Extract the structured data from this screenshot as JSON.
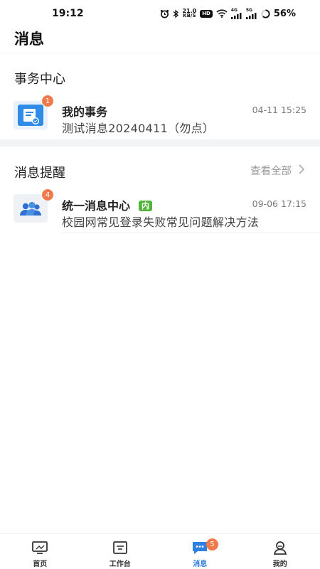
{
  "status_bar": {
    "time": "19:12",
    "net_speed_value": "21.0",
    "net_speed_unit": "KB/S",
    "hd_label": "HD",
    "sim1_label": "4G",
    "sim2_label": "5G",
    "battery": "56%"
  },
  "header": {
    "title": "消息"
  },
  "affairs": {
    "section_title": "事务中心",
    "item": {
      "title": "我的事务",
      "subtitle": "测试消息20240411（勿点）",
      "time": "04-11 15:25",
      "badge": "1",
      "icon": "document-icon",
      "accent": "#2f8be8"
    }
  },
  "reminders": {
    "section_title": "消息提醒",
    "view_all": "查看全部",
    "item": {
      "title": "统一消息中心",
      "tag": "内",
      "subtitle": "校园网常见登录失败常见问题解决方法",
      "time": "09-06 17:15",
      "badge": "4",
      "icon": "group-users-icon",
      "tag_color": "#52b43c"
    }
  },
  "tabbar": {
    "active": "消息",
    "accent": "#2f7fe0",
    "tabs": [
      {
        "label": "首页",
        "icon": "monitor-icon"
      },
      {
        "label": "工作台",
        "icon": "workbench-icon"
      },
      {
        "label": "消息",
        "icon": "chat-icon",
        "badge": "5"
      },
      {
        "label": "我的",
        "icon": "profile-icon"
      }
    ]
  }
}
